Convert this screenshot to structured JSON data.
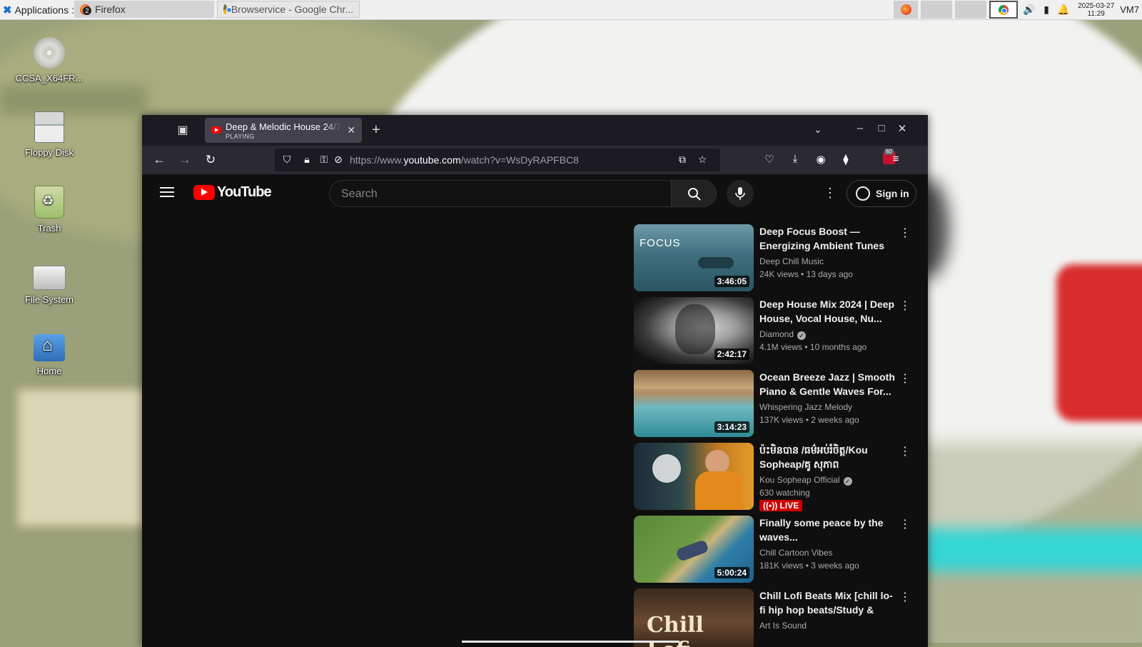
{
  "taskbar": {
    "applications_label": "Applications",
    "tasks": [
      {
        "label": "Firefox",
        "badge": "2"
      },
      {
        "label": "Browservice - Google Chr..."
      }
    ],
    "clock_date": "2025-03-27",
    "clock_time": "11:29",
    "user_label": "VM7"
  },
  "desktop": {
    "icons": [
      {
        "label": "CCSA_X64FR...",
        "icon": "cd-icon"
      },
      {
        "label": "Floppy Disk",
        "icon": "floppy-icon"
      },
      {
        "label": "Trash",
        "icon": "trash-icon"
      },
      {
        "label": "File System",
        "icon": "drive-icon"
      },
      {
        "label": "Home",
        "icon": "home-folder-icon"
      }
    ]
  },
  "browser": {
    "tab": {
      "title": "Deep & Melodic House 24/7",
      "status": "PLAYING"
    },
    "url_prefix": "https://www.",
    "url_domain": "youtube.com",
    "url_path": "/watch?v=WsDyRAPFBC8",
    "extension_count": "60"
  },
  "youtube": {
    "logo_text": "YouTube",
    "search_placeholder": "Search",
    "sign_in_label": "Sign in",
    "recommendations": [
      {
        "title": "Deep Focus Boost — Energizing Ambient Tunes f...",
        "channel": "Deep Chill Music",
        "views": "24K views",
        "age": "13 days ago",
        "duration": "3:46:05",
        "thumb_text": "FOCUS",
        "verified": false
      },
      {
        "title": "Deep House Mix 2024 | Deep House, Vocal House, Nu...",
        "channel": "Diamond",
        "views": "4.1M views",
        "age": "10 months ago",
        "duration": "2:42:17",
        "verified": true
      },
      {
        "title": "Ocean Breeze Jazz | Smooth Piano & Gentle Waves For...",
        "channel": "Whispering Jazz Melody",
        "views": "137K views",
        "age": "2 weeks ago",
        "duration": "3:14:23",
        "verified": false
      },
      {
        "title": "ប៉ះមិនបាន /ធម៌អប់រំចិត្ត/Kou Sopheap/គូ សុភាព",
        "channel": "Kou Sopheap Official",
        "watching": "630 watching",
        "live_label": "LIVE",
        "verified": true
      },
      {
        "title": "Finally some peace by the waves...",
        "channel": "Chill Cartoon Vibes",
        "views": "181K views",
        "age": "3 weeks ago",
        "duration": "5:00:24",
        "verified": false
      },
      {
        "title": "Chill Lofi Beats Mix [chill lo-fi hip hop beats/Study & Relax...",
        "channel": "Art Is Sound",
        "thumb_text": "Chill Lofi",
        "verified": false
      }
    ]
  },
  "colors": {
    "youtube_red": "#ff0000",
    "live_red": "#cc0000",
    "page_bg": "#0f0f0f",
    "toolbar": "#2b2a33"
  }
}
